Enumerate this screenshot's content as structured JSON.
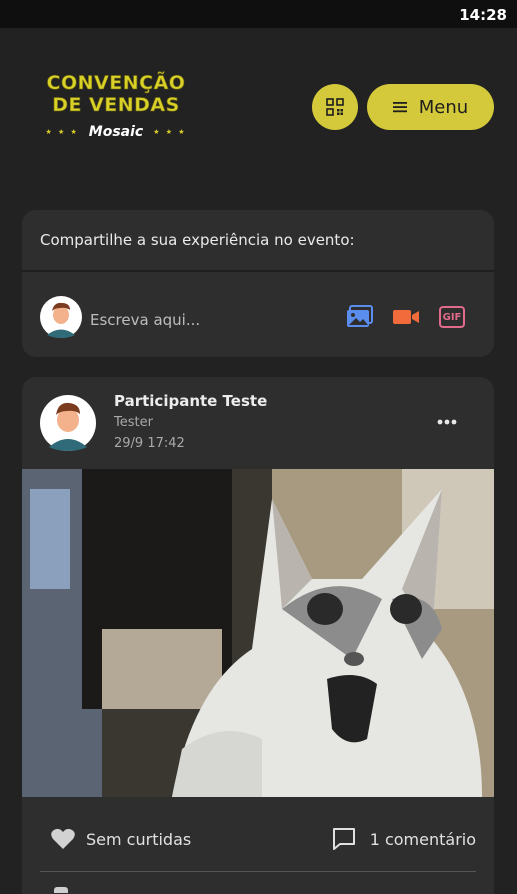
{
  "status_bar": {
    "time": "14:28"
  },
  "header": {
    "logo": {
      "line1": "CONVENÇÃO",
      "line2": "DE VENDAS",
      "brand": "Mosaic",
      "stars": "★ ★ ★"
    },
    "qr_icon": "qr-code-icon",
    "menu_label": "Menu",
    "menu_icon": "hamburger-icon"
  },
  "share": {
    "title": "Compartilhe a sua experiência no evento:",
    "placeholder": "Escreva aqui...",
    "icons": [
      "image-icon",
      "video-camera-icon",
      "gif-icon"
    ],
    "gif_label": "GIF"
  },
  "post": {
    "author": "Participante Teste",
    "role": "Tester",
    "timestamp": "29/9 17:42",
    "likes_label": "Sem curtidas",
    "comments_label": "1 comentário"
  },
  "colors": {
    "accent": "#d3c93a",
    "background": "#222222",
    "card": "#2e2e2e",
    "image_icon": "#5b8def",
    "video_icon": "#f26b3a",
    "gif_icon": "#e26a8a"
  }
}
